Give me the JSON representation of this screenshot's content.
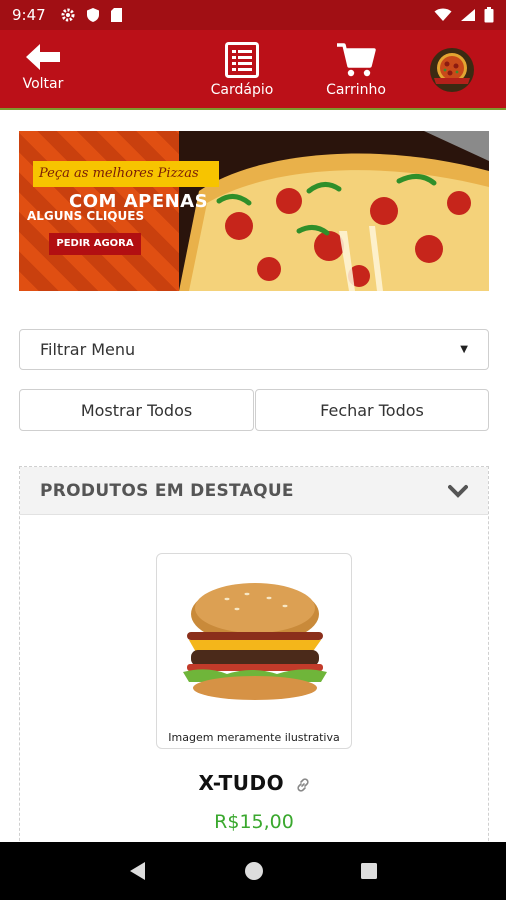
{
  "status_bar": {
    "time": "9:47",
    "icons_left": [
      "settings-icon",
      "shield-icon",
      "sd-card-icon"
    ],
    "icons_right": [
      "wifi-icon",
      "signal-icon",
      "battery-icon"
    ]
  },
  "header": {
    "back_label": "Voltar",
    "menu_label": "Cardápio",
    "cart_label": "Carrinho",
    "colors": {
      "bar": "#bb1018",
      "status": "#a10f14"
    }
  },
  "banner": {
    "line1": "Peça as melhores Pizzas",
    "line2": "COM APENAS",
    "line3": "ALGUNS CLIQUES",
    "cta": "PEDIR AGORA"
  },
  "filter": {
    "selected": "Filtrar Menu"
  },
  "actions": {
    "show_all": "Mostrar Todos",
    "close_all": "Fechar Todos"
  },
  "section": {
    "title": "PRODUTOS EM DESTAQUE",
    "product": {
      "caption": "Imagem meramente ilustrativa",
      "name": "X-TUDO",
      "price": "R$15,00",
      "price_color": "#3aa82e"
    }
  }
}
